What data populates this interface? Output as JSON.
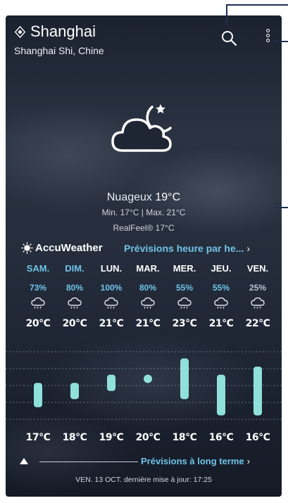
{
  "location": {
    "city": "Shanghai",
    "region": "Shanghai Shi, Chine"
  },
  "current": {
    "condition": "Nuageux",
    "temp": "19°C",
    "minmax": "Min. 17°C  |  Max. 21°C",
    "realfeel": "RealFeel® 17°C"
  },
  "provider": "AccuWeather",
  "hourly_link": "Prévisions heure par he...",
  "days": [
    {
      "name": "SAM.",
      "pct": "73%",
      "hi": "20°C",
      "lo": "17°C",
      "active": true
    },
    {
      "name": "DIM.",
      "pct": "80%",
      "hi": "20°C",
      "lo": "18°C",
      "active": true
    },
    {
      "name": "LUN.",
      "pct": "100%",
      "hi": "21°C",
      "lo": "19°C",
      "active": false
    },
    {
      "name": "MAR.",
      "pct": "80%",
      "hi": "21°C",
      "lo": "20°C",
      "active": false
    },
    {
      "name": "MER.",
      "pct": "55%",
      "hi": "23°C",
      "lo": "18°C",
      "active": false
    },
    {
      "name": "JEU.",
      "pct": "55%",
      "hi": "21°C",
      "lo": "16°C",
      "active": false
    },
    {
      "name": "VEN.",
      "pct": "25%",
      "hi": "22°C",
      "lo": "16°C",
      "active": false
    }
  ],
  "long_term_link": "Prévisions à long terme",
  "updated": "VEN. 13 OCT. dernière mise à jour: 17:25",
  "colors": {
    "accent": "#6fc3e8",
    "bar": "#8fe0da",
    "pct_dim": "#b9c1cc"
  },
  "icons": {
    "location": "location-pin-icon",
    "search": "search-icon",
    "menu": "more-vertical-icon",
    "weather": "cloudy-night-moon-icon",
    "provider": "sun-icon",
    "precip": "rain-cloud-icon",
    "arrow": "up-arrow-icon"
  }
}
